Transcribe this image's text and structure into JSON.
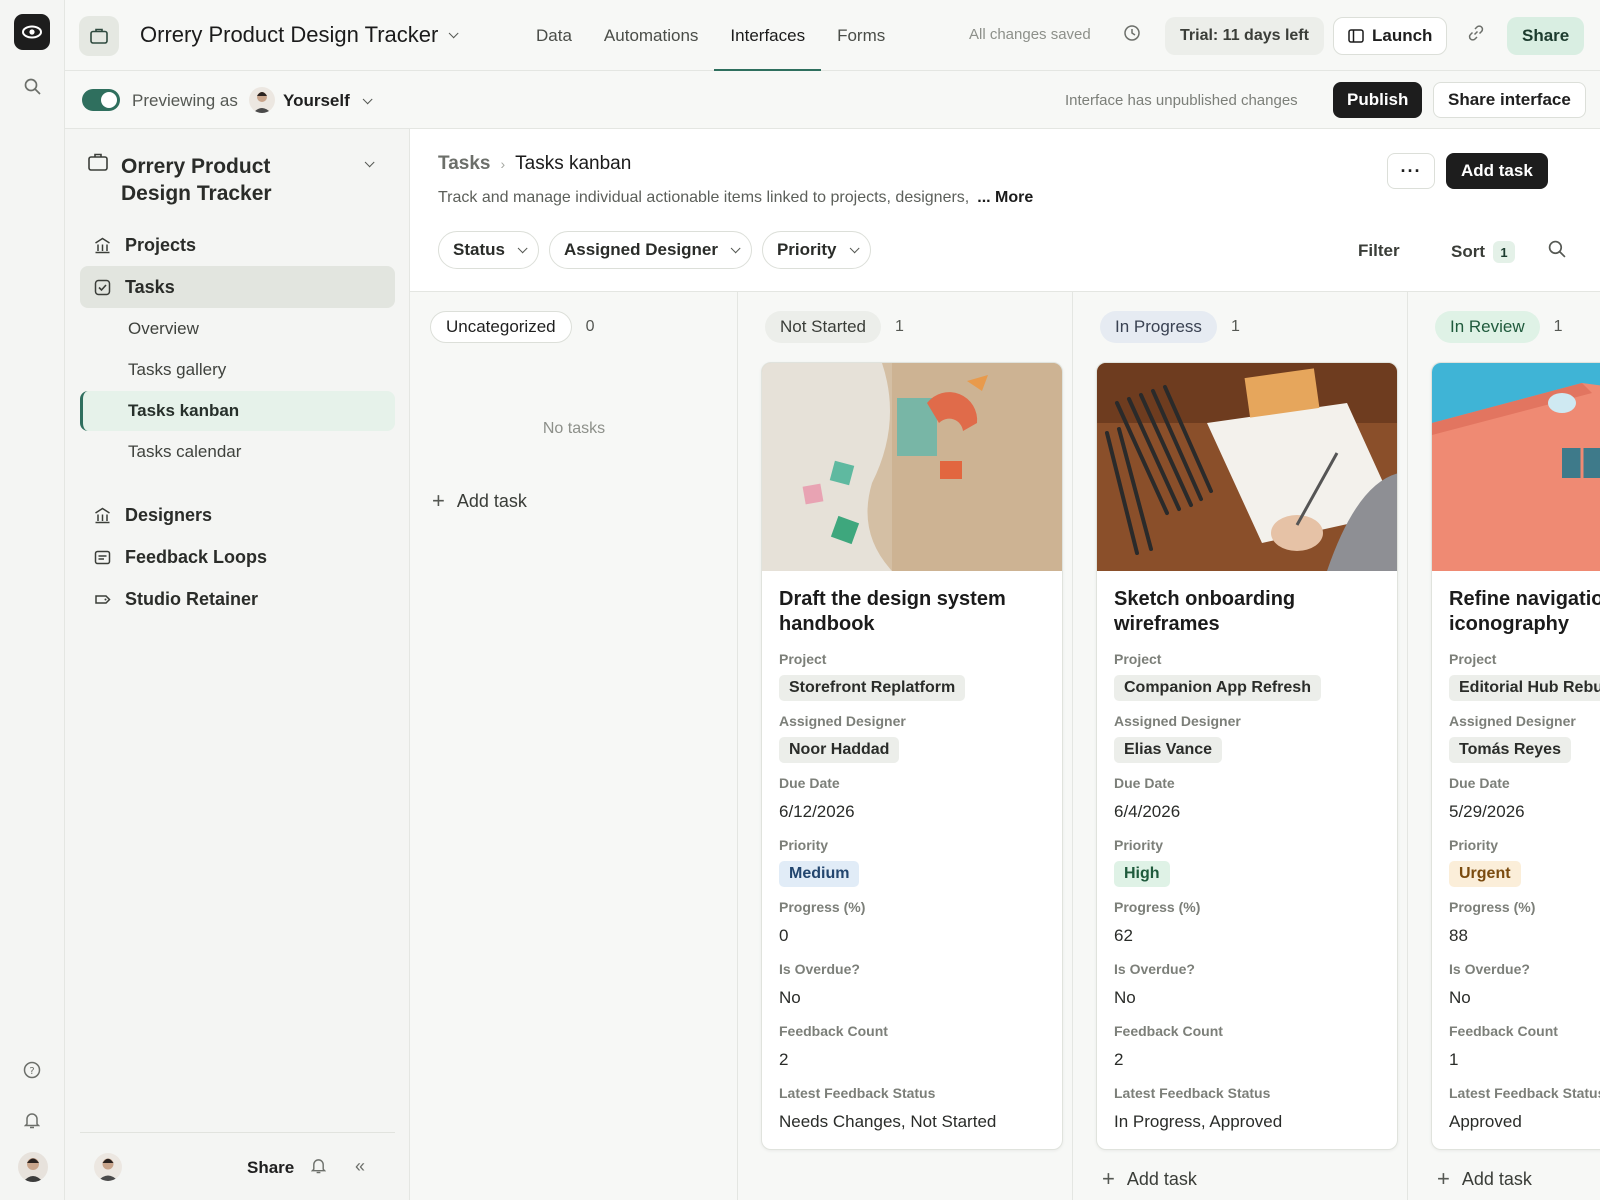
{
  "topbar": {
    "base_title": "Orrery Product Design Tracker",
    "tabs": [
      {
        "label": "Data",
        "active": false
      },
      {
        "label": "Automations",
        "active": false
      },
      {
        "label": "Interfaces",
        "active": true
      },
      {
        "label": "Forms",
        "active": false
      }
    ],
    "saved": "All changes saved",
    "trial": "Trial: 11 days left",
    "launch": "Launch",
    "share": "Share"
  },
  "preview": {
    "label": "Previewing as",
    "user": "Yourself",
    "unpublished": "Interface has unpublished changes",
    "publish": "Publish",
    "share_interface": "Share interface"
  },
  "sidebar": {
    "title": "Orrery Product Design Tracker",
    "items": [
      {
        "label": "Projects",
        "icon": "building-icon"
      },
      {
        "label": "Tasks",
        "icon": "checkbox-icon"
      },
      {
        "label": "Designers",
        "icon": "building-icon"
      },
      {
        "label": "Feedback Loops",
        "icon": "message-icon"
      },
      {
        "label": "Studio Retainer",
        "icon": "tag-icon"
      }
    ],
    "subitems": [
      "Overview",
      "Tasks gallery",
      "Tasks kanban",
      "Tasks calendar"
    ],
    "footer_share": "Share"
  },
  "page": {
    "breadcrumb_root": "Tasks",
    "breadcrumb_current": "Tasks kanban",
    "description": "Track and manage individual actionable items linked to projects, designers,",
    "more": "... More",
    "dots": "···",
    "add_task": "Add task",
    "filters": [
      "Status",
      "Assigned Designer",
      "Priority"
    ],
    "filter": "Filter",
    "sort": "Sort",
    "sort_count": "1"
  },
  "board": {
    "no_tasks": "No tasks",
    "add_task": "Add task",
    "field_labels": {
      "project": "Project",
      "designer": "Assigned Designer",
      "due": "Due Date",
      "priority": "Priority",
      "progress": "Progress (%)",
      "overdue": "Is Overdue?",
      "feedback_count": "Feedback Count",
      "feedback_status": "Latest Feedback Status"
    },
    "columns": [
      {
        "label": "Uncategorized",
        "count": "0",
        "style": "outline"
      },
      {
        "label": "Not Started",
        "count": "1",
        "bg": "#eceeea",
        "fg": "#3a3d38"
      },
      {
        "label": "In Progress",
        "count": "1",
        "bg": "#e6ebf2",
        "fg": "#3a4252"
      },
      {
        "label": "In Review",
        "count": "1",
        "bg": "#dff2e6",
        "fg": "#1f5a3c"
      }
    ],
    "cards": [
      {
        "title": "Draft the design system handbook",
        "project": "Storefront Replatform",
        "designer": "Noor Haddad",
        "due": "6/12/2026",
        "priority": "Medium",
        "priority_bg": "#e1ecf7",
        "priority_fg": "#23466e",
        "progress": "0",
        "overdue": "No",
        "feedback_count": "2",
        "feedback_status": "Needs Changes, Not Started"
      },
      {
        "title": "Sketch onboarding wireframes",
        "project": "Companion App Refresh",
        "designer": "Elias Vance",
        "due": "6/4/2026",
        "priority": "High",
        "priority_bg": "#dff2e6",
        "priority_fg": "#1f5a3c",
        "progress": "62",
        "overdue": "No",
        "feedback_count": "2",
        "feedback_status": "In Progress, Approved"
      },
      {
        "title": "Refine navigation iconography",
        "project": "Editorial Hub Rebuild",
        "designer": "Tomás Reyes",
        "due": "5/29/2026",
        "priority": "Urgent",
        "priority_bg": "#fbeed9",
        "priority_fg": "#7a4b0f",
        "progress": "88",
        "overdue": "No",
        "feedback_count": "1",
        "feedback_status": "Approved"
      }
    ]
  },
  "colors": {
    "accent": "#2f6f5e",
    "dark": "#1d1d1d"
  }
}
